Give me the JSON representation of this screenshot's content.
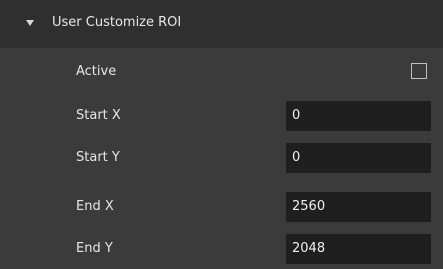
{
  "section": {
    "title": "User Customize ROI",
    "expanded": true,
    "caret_icon": "caret-down-icon"
  },
  "active": {
    "label": "Active",
    "checked": false
  },
  "fields": [
    {
      "label": "Start X",
      "value": "0"
    },
    {
      "label": "Start Y",
      "value": "0"
    },
    {
      "label": "End X",
      "value": "2560"
    },
    {
      "label": "End Y",
      "value": "2048"
    }
  ]
}
